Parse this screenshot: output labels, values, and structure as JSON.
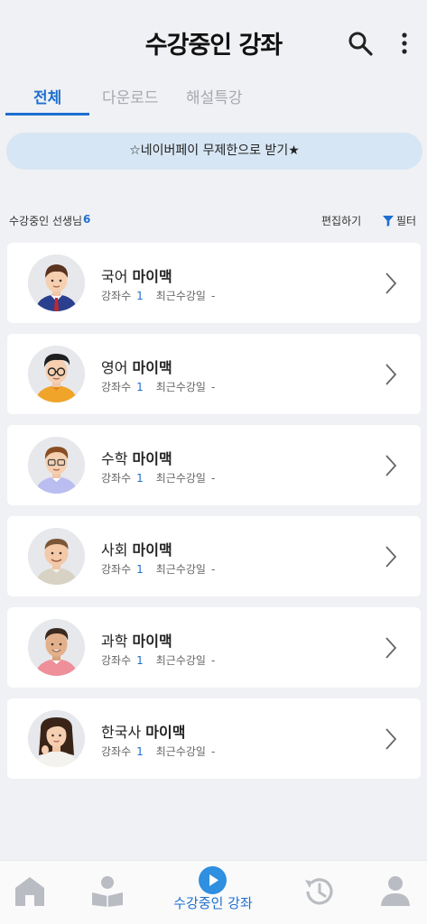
{
  "header": {
    "title": "수강중인 강좌"
  },
  "tabs": [
    {
      "label": "전체"
    },
    {
      "label": "다운로드"
    },
    {
      "label": "해설특강"
    }
  ],
  "promo": {
    "text": "☆네이버페이 무제한으로 받기★"
  },
  "section": {
    "count_label": "수강중인 선생님",
    "count": "6",
    "edit_label": "편집하기",
    "filter_label": "필터"
  },
  "teachers": [
    {
      "subject": "국어",
      "name": "마이맥",
      "lectures_label": "강좌수",
      "lectures": "1",
      "recent_label": "최근수강일",
      "recent": "-"
    },
    {
      "subject": "영어",
      "name": "마이맥",
      "lectures_label": "강좌수",
      "lectures": "1",
      "recent_label": "최근수강일",
      "recent": "-"
    },
    {
      "subject": "수학",
      "name": "마이맥",
      "lectures_label": "강좌수",
      "lectures": "1",
      "recent_label": "최근수강일",
      "recent": "-"
    },
    {
      "subject": "사회",
      "name": "마이맥",
      "lectures_label": "강좌수",
      "lectures": "1",
      "recent_label": "최근수강일",
      "recent": "-"
    },
    {
      "subject": "과학",
      "name": "마이맥",
      "lectures_label": "강좌수",
      "lectures": "1",
      "recent_label": "최근수강일",
      "recent": "-"
    },
    {
      "subject": "한국사",
      "name": "마이맥",
      "lectures_label": "강좌수",
      "lectures": "1",
      "recent_label": "최근수강일",
      "recent": "-"
    }
  ],
  "bottom_nav": {
    "active_label": "수강중인 강좌",
    "items": [
      "home-icon",
      "reading-icon",
      "play-icon",
      "history-icon",
      "profile-icon"
    ]
  },
  "colors": {
    "accent": "#1d6fd0",
    "promo_bg": "#d7e6f4",
    "background": "#f0f1f4"
  }
}
